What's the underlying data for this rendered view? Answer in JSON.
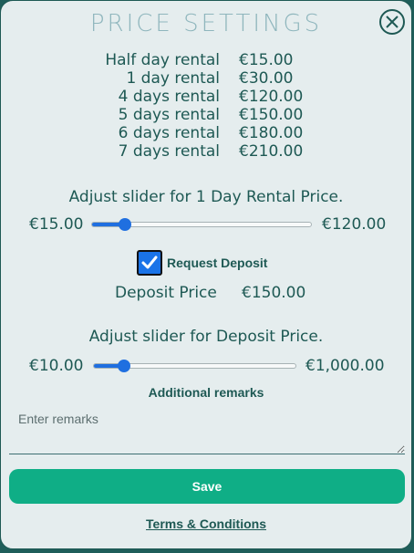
{
  "title": "PRICE  SETTINGS",
  "close_icon": "close-circle-x-icon",
  "rates": [
    {
      "label": "Half day rental",
      "price": "€15.00"
    },
    {
      "label": "1 day rental",
      "price": "€30.00"
    },
    {
      "label": "4 days rental",
      "price": "€120.00"
    },
    {
      "label": "5 days rental",
      "price": "€150.00"
    },
    {
      "label": "6 days rental",
      "price": "€180.00"
    },
    {
      "label": "7 days rental",
      "price": "€210.00"
    }
  ],
  "rental_slider": {
    "caption": "Adjust slider for 1 Day Rental Price.",
    "min_label": "€15.00",
    "max_label": "€120.00",
    "value_fraction": 0.15
  },
  "deposit": {
    "checkbox_label": "Request Deposit",
    "checked": true,
    "price_label": "Deposit Price",
    "price_value": "€150.00"
  },
  "deposit_slider": {
    "caption": "Adjust slider for Deposit Price.",
    "min_label": "€10.00",
    "max_label": "€1,000.00",
    "value_fraction": 0.15
  },
  "remarks": {
    "title": "Additional remarks",
    "placeholder": "Enter remarks"
  },
  "save_label": "Save",
  "terms_label": "Terms & Conditions",
  "colors": {
    "accent": "#0fae86",
    "slider": "#1f6fe0",
    "text": "#1e5954",
    "title": "#8fb6bd"
  }
}
